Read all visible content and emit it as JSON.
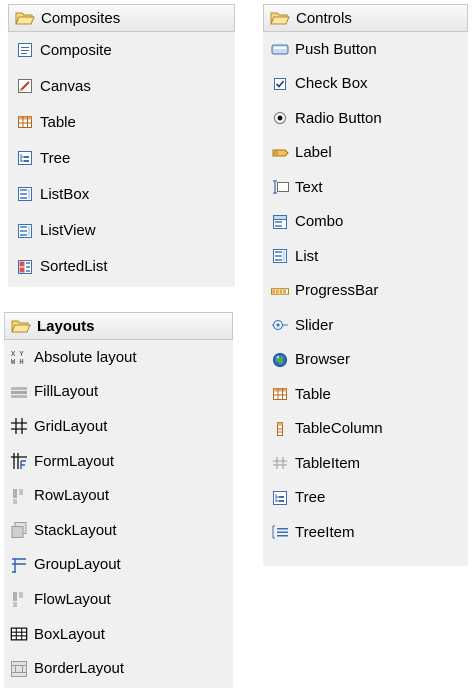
{
  "composites": {
    "header": "Composites",
    "items": [
      {
        "label": "Composite",
        "icon": "composite-icon"
      },
      {
        "label": "Canvas",
        "icon": "canvas-icon"
      },
      {
        "label": "Table",
        "icon": "table-icon"
      },
      {
        "label": "Tree",
        "icon": "tree-icon"
      },
      {
        "label": "ListBox",
        "icon": "listbox-icon"
      },
      {
        "label": "ListView",
        "icon": "listview-icon"
      },
      {
        "label": "SortedList",
        "icon": "sortedlist-icon"
      }
    ]
  },
  "controls": {
    "header": "Controls",
    "items": [
      {
        "label": "Push Button",
        "icon": "push-button-icon"
      },
      {
        "label": "Check Box",
        "icon": "check-box-icon"
      },
      {
        "label": "Radio Button",
        "icon": "radio-button-icon"
      },
      {
        "label": "Label",
        "icon": "label-icon"
      },
      {
        "label": "Text",
        "icon": "text-icon"
      },
      {
        "label": "Combo",
        "icon": "combo-icon"
      },
      {
        "label": "List",
        "icon": "list-icon"
      },
      {
        "label": "ProgressBar",
        "icon": "progressbar-icon"
      },
      {
        "label": "Slider",
        "icon": "slider-icon"
      },
      {
        "label": "Browser",
        "icon": "browser-icon"
      },
      {
        "label": "Table",
        "icon": "table-icon"
      },
      {
        "label": "TableColumn",
        "icon": "tablecolumn-icon"
      },
      {
        "label": "TableItem",
        "icon": "tableitem-icon"
      },
      {
        "label": "Tree",
        "icon": "tree-icon"
      },
      {
        "label": "TreeItem",
        "icon": "treeitem-icon"
      }
    ]
  },
  "layouts": {
    "header": "Layouts",
    "items": [
      {
        "label": "Absolute layout",
        "icon": "absolute-layout-icon"
      },
      {
        "label": "FillLayout",
        "icon": "filllayout-icon"
      },
      {
        "label": "GridLayout",
        "icon": "gridlayout-icon"
      },
      {
        "label": "FormLayout",
        "icon": "formlayout-icon"
      },
      {
        "label": "RowLayout",
        "icon": "rowlayout-icon"
      },
      {
        "label": "StackLayout",
        "icon": "stacklayout-icon"
      },
      {
        "label": "GroupLayout",
        "icon": "grouplayout-icon"
      },
      {
        "label": "FlowLayout",
        "icon": "flowlayout-icon"
      },
      {
        "label": "BoxLayout",
        "icon": "boxlayout-icon"
      },
      {
        "label": "BorderLayout",
        "icon": "borderlayout-icon"
      }
    ]
  },
  "colors": {
    "panel_bg": "#f0f0f0",
    "header_border": "#c9c9c9",
    "folder_fill": "#f7d97a",
    "folder_stroke": "#c8a24a",
    "icon_blue": "#3d6fb6"
  }
}
